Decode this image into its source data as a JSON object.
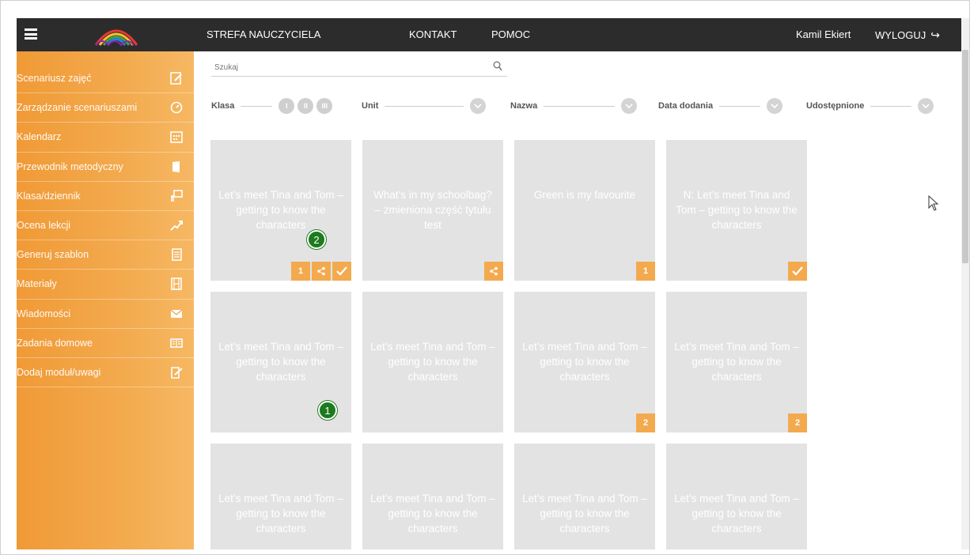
{
  "topbar": {
    "zone": "STREFA NAUCZYCIELA",
    "kontakt": "KONTAKT",
    "pomoc": "POMOC",
    "user": "Kamil Ekiert",
    "logout": "WYLOGUJ"
  },
  "sidebar": {
    "items": [
      {
        "label": "Scenariusz zajęć",
        "icon": "edit-note-icon"
      },
      {
        "label": "Zarządzanie scenariuszami",
        "icon": "dashboard-gauge-icon"
      },
      {
        "label": "Kalendarz",
        "icon": "calendar-icon"
      },
      {
        "label": "Przewodnik metodyczny",
        "icon": "book-icon"
      },
      {
        "label": "Klasa/dziennik",
        "icon": "teacher-board-icon"
      },
      {
        "label": "Ocena lekcji",
        "icon": "chart-up-icon"
      },
      {
        "label": "Generuj szablon",
        "icon": "template-icon"
      },
      {
        "label": "Materiały",
        "icon": "film-icon"
      },
      {
        "label": "Wiadomości",
        "icon": "envelope-icon"
      },
      {
        "label": "Zadania domowe",
        "icon": "open-book-icon"
      },
      {
        "label": "Dodaj moduł/uwagi",
        "icon": "add-note-icon"
      }
    ]
  },
  "search": {
    "placeholder": "Szukaj"
  },
  "filters": {
    "klasa": "Klasa",
    "klasa_levels": [
      "I",
      "II",
      "III"
    ],
    "unit": "Unit",
    "nazwa": "Nazwa",
    "data": "Data dodania",
    "udostepnione": "Udostępnione"
  },
  "cards": [
    {
      "title": "Let’s meet Tina and Tom – getting to know the characters",
      "badges": [
        "1",
        "share",
        "check"
      ]
    },
    {
      "title": "What’s in my schoolbag? – zmieniona część tytułu test",
      "badges": [
        "share"
      ]
    },
    {
      "title": "Green is my favourite",
      "badges": [
        "1"
      ]
    },
    {
      "title": "N: Let’s meet Tina and Tom – getting to know the characters",
      "badges": [
        "check"
      ]
    },
    {
      "title": "Let’s meet Tina and Tom – getting to know the characters",
      "badges": []
    },
    {
      "title": "Let’s meet Tina and Tom – getting to know the characters",
      "badges": []
    },
    {
      "title": "Let’s meet Tina and Tom – getting to know the characters",
      "badges": [
        "2"
      ]
    },
    {
      "title": "Let’s meet Tina and Tom – getting to know the characters",
      "badges": [
        "2"
      ]
    },
    {
      "title": "Let’s meet Tina and Tom – getting to know the characters",
      "badges": []
    },
    {
      "title": "Let’s meet Tina and Tom – getting to know the characters",
      "badges": []
    },
    {
      "title": "Let’s meet Tina and Tom – getting to know the characters",
      "badges": []
    },
    {
      "title": "Let’s meet Tina and Tom – getting to know the characters",
      "badges": []
    }
  ],
  "markers": {
    "first": "1",
    "second": "2"
  },
  "colors": {
    "accent": "#f3aa4e",
    "topbar": "#2c2c2c",
    "card": "#e3e3e3",
    "marker": "#1e7a1e"
  }
}
